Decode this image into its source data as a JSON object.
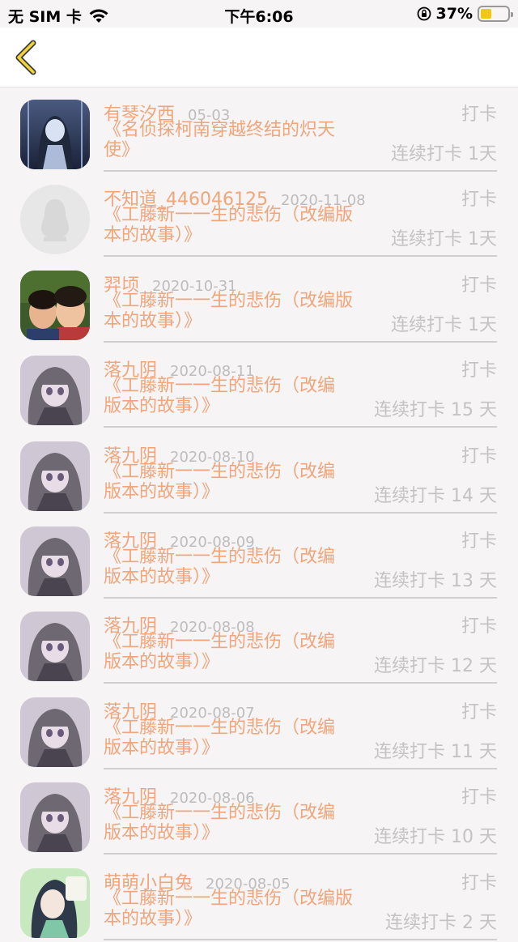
{
  "status_bar": {
    "carrier": "无 SIM 卡",
    "time": "下午6:06",
    "battery_percent": "37%",
    "battery_level": 0.37
  },
  "nav": {
    "back_icon": "chevron-left-icon"
  },
  "colors": {
    "accent": "#f0a57b",
    "muted": "#c3c3c3",
    "battery": "#f5c518"
  },
  "entries": [
    {
      "name": "有琴汐西",
      "date": "05-03",
      "title": "《名侦探柯南穿越终结的炽天\n使》",
      "checkin": "打卡",
      "streak": "连续打卡 1天",
      "avatar": "anime-girl-blue"
    },
    {
      "name": "不知道_446046125",
      "date": "2020-11-08",
      "title": "《工藤新一一生的悲伤（改编版\n本的故事）》",
      "checkin": "打卡",
      "streak": "连续打卡 1天",
      "avatar": "default-penguin"
    },
    {
      "name": "羿顷",
      "date": "2020-10-31",
      "title": "《工藤新一一生的悲伤（改编版\n本的故事）》",
      "checkin": "打卡",
      "streak": "连续打卡 1天",
      "avatar": "photo-kids"
    },
    {
      "name": "落九阴",
      "date": "2020-08-11",
      "title": "《工藤新一一生的悲伤（改编\n版本的故事）》",
      "checkin": "打卡",
      "streak": "连续打卡 15 天",
      "avatar": "anime-girl-grey"
    },
    {
      "name": "落九阴",
      "date": "2020-08-10",
      "title": "《工藤新一一生的悲伤（改编\n版本的故事）》",
      "checkin": "打卡",
      "streak": "连续打卡 14 天",
      "avatar": "anime-girl-grey"
    },
    {
      "name": "落九阴",
      "date": "2020-08-09",
      "title": "《工藤新一一生的悲伤（改编\n版本的故事）》",
      "checkin": "打卡",
      "streak": "连续打卡 13 天",
      "avatar": "anime-girl-grey"
    },
    {
      "name": "落九阴",
      "date": "2020-08-08",
      "title": "《工藤新一一生的悲伤（改编\n版本的故事）》",
      "checkin": "打卡",
      "streak": "连续打卡 12 天",
      "avatar": "anime-girl-grey"
    },
    {
      "name": "落九阴",
      "date": "2020-08-07",
      "title": "《工藤新一一生的悲伤（改编\n版本的故事）》",
      "checkin": "打卡",
      "streak": "连续打卡 11 天",
      "avatar": "anime-girl-grey"
    },
    {
      "name": "落九阴",
      "date": "2020-08-06",
      "title": "《工藤新一一生的悲伤（改编\n版本的故事）》",
      "checkin": "打卡",
      "streak": "连续打卡 10 天",
      "avatar": "anime-girl-grey"
    },
    {
      "name": "萌萌小白兔",
      "date": "2020-08-05",
      "title": "《工藤新一一生的悲伤（改编版\n本的故事）》",
      "checkin": "打卡",
      "streak": "连续打卡 2 天",
      "avatar": "anime-girl-green"
    }
  ]
}
